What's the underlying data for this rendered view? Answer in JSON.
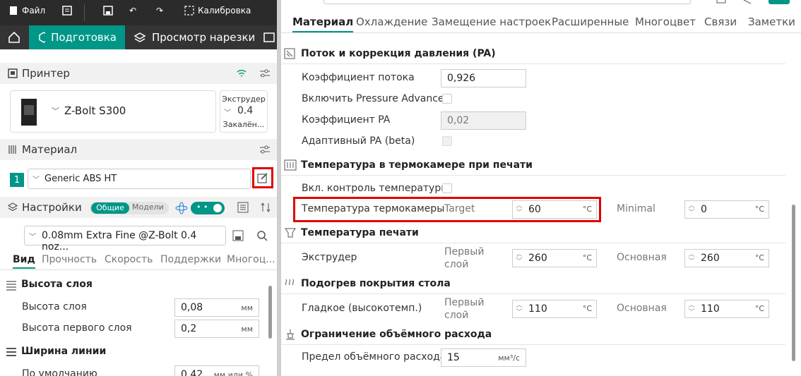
{
  "topbar": {
    "file_label": "Файл",
    "calibration_label": "Калибровка"
  },
  "tabs": {
    "prepare_label": "Подготовка",
    "preview_label": "Просмотр нарезки"
  },
  "printer": {
    "section_title": "Принтер",
    "name": "Z-Bolt S300",
    "extruder_label": "Экструдер",
    "nozzle_value": "0.4",
    "hardened_label": "Закалён..."
  },
  "material": {
    "section_title": "Материал",
    "slot_number": "1",
    "filament_name": "Generic ABS HT"
  },
  "settings": {
    "section_title": "Настройки",
    "toggle_common": "Общие",
    "toggle_models": "Модели",
    "preset_name": "0.08mm Extra Fine @Z-Bolt 0.4 noz...",
    "subtabs": [
      "Вид",
      "Прочность",
      "Скорость",
      "Поддержки",
      "Многоц..."
    ],
    "layer_height_group": "Высота слоя",
    "layer_height_label": "Высота слоя",
    "layer_height_value": "0,08",
    "layer_height_unit": "мм",
    "first_layer_label": "Высота первого слоя",
    "first_layer_value": "0,2",
    "first_layer_unit": "мм",
    "line_width_group": "Ширина линии",
    "default_label": "По умолчанию",
    "default_value": "0,42",
    "default_unit": "мм или %"
  },
  "dialog": {
    "tabs": [
      "Материал",
      "Охлаждение",
      "Замещение настроек",
      "Расширенные",
      "Многоцвет",
      "Связи",
      "Заметки"
    ],
    "flow_section": "Поток и коррекция давления (PA)",
    "flow_ratio_label": "Коэффициент потока",
    "flow_ratio_value": "0,926",
    "pa_enable_label": "Включить Pressure Advance",
    "pa_ratio_label": "Коэффициент PA",
    "pa_ratio_value": "0,02",
    "adaptive_pa_label": "Адаптивный PA (beta)",
    "chamber_section": "Температура в термокамере при печати",
    "chamber_control_label": "Вкл. контроль температуры",
    "chamber_temp_label": "Температура термокамеры",
    "target_label": "Target",
    "target_value": "60",
    "minimal_label": "Minimal",
    "minimal_value": "0",
    "temp_unit": "°C",
    "print_temp_section": "Температура печати",
    "extruder_label": "Экструдер",
    "first_layer_label": "Первый слой",
    "extruder_first_value": "260",
    "main_label": "Основная",
    "extruder_main_value": "260",
    "bed_section": "Подогрев покрытия стола",
    "smooth_plate_label": "Гладкое (высокотемп.)",
    "bed_first_value": "110",
    "bed_main_value": "110",
    "volumetric_section": "Ограничение объёмного расхода",
    "volumetric_label": "Предел объёмного расхода",
    "volumetric_value": "15",
    "volumetric_unit": "мм³/с"
  }
}
